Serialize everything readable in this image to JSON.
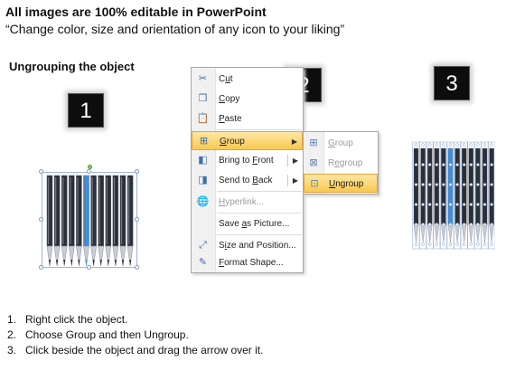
{
  "header": {
    "title": "All images are 100% editable in PowerPoint",
    "subtitle": "“Change color, size and orientation of any icon to your liking”"
  },
  "section_title": "Ungrouping the object",
  "badges": [
    "1",
    "2",
    "3"
  ],
  "context_menu": {
    "items": [
      {
        "label": "Cut",
        "icon": "scissors-icon",
        "glyph": "✂"
      },
      {
        "label": "Copy",
        "icon": "copy-icon",
        "glyph": "❐"
      },
      {
        "label": "Paste",
        "icon": "paste-icon",
        "glyph": "📋"
      },
      {
        "label": "Group",
        "icon": "group-icon",
        "glyph": "⊞"
      },
      {
        "label": "Bring to Front",
        "icon": "bring-to-front-icon",
        "glyph": "◧"
      },
      {
        "label": "Send to Back",
        "icon": "send-to-back-icon",
        "glyph": "◨"
      },
      {
        "label": "Hyperlink...",
        "icon": "hyperlink-icon",
        "glyph": "🌐"
      },
      {
        "label": "Save as Picture...",
        "icon": "",
        "glyph": ""
      },
      {
        "label": "Size and Position...",
        "icon": "size-position-icon",
        "glyph": "⤢"
      },
      {
        "label": "Format Shape...",
        "icon": "format-shape-icon",
        "glyph": "✎"
      }
    ]
  },
  "submenu": {
    "items": [
      {
        "label": "Group",
        "icon": "group-icon",
        "glyph": "⊞"
      },
      {
        "label": "Regroup",
        "icon": "regroup-icon",
        "glyph": "⊠"
      },
      {
        "label": "Ungroup",
        "icon": "ungroup-icon",
        "glyph": "⊡"
      }
    ]
  },
  "steps": [
    {
      "num": "1.",
      "text": "Right click the object."
    },
    {
      "num": "2.",
      "text": "Choose Group and then Ungroup."
    },
    {
      "num": "3.",
      "text": "Click beside the object and drag the arrow over it."
    }
  ],
  "colors": {
    "highlight_top": "#fde7a6",
    "highlight_bottom": "#f8c94f",
    "pencil_body": "#2b2f36",
    "pencil_accent": "#3d8fe0",
    "selection": "#9db6d8"
  }
}
